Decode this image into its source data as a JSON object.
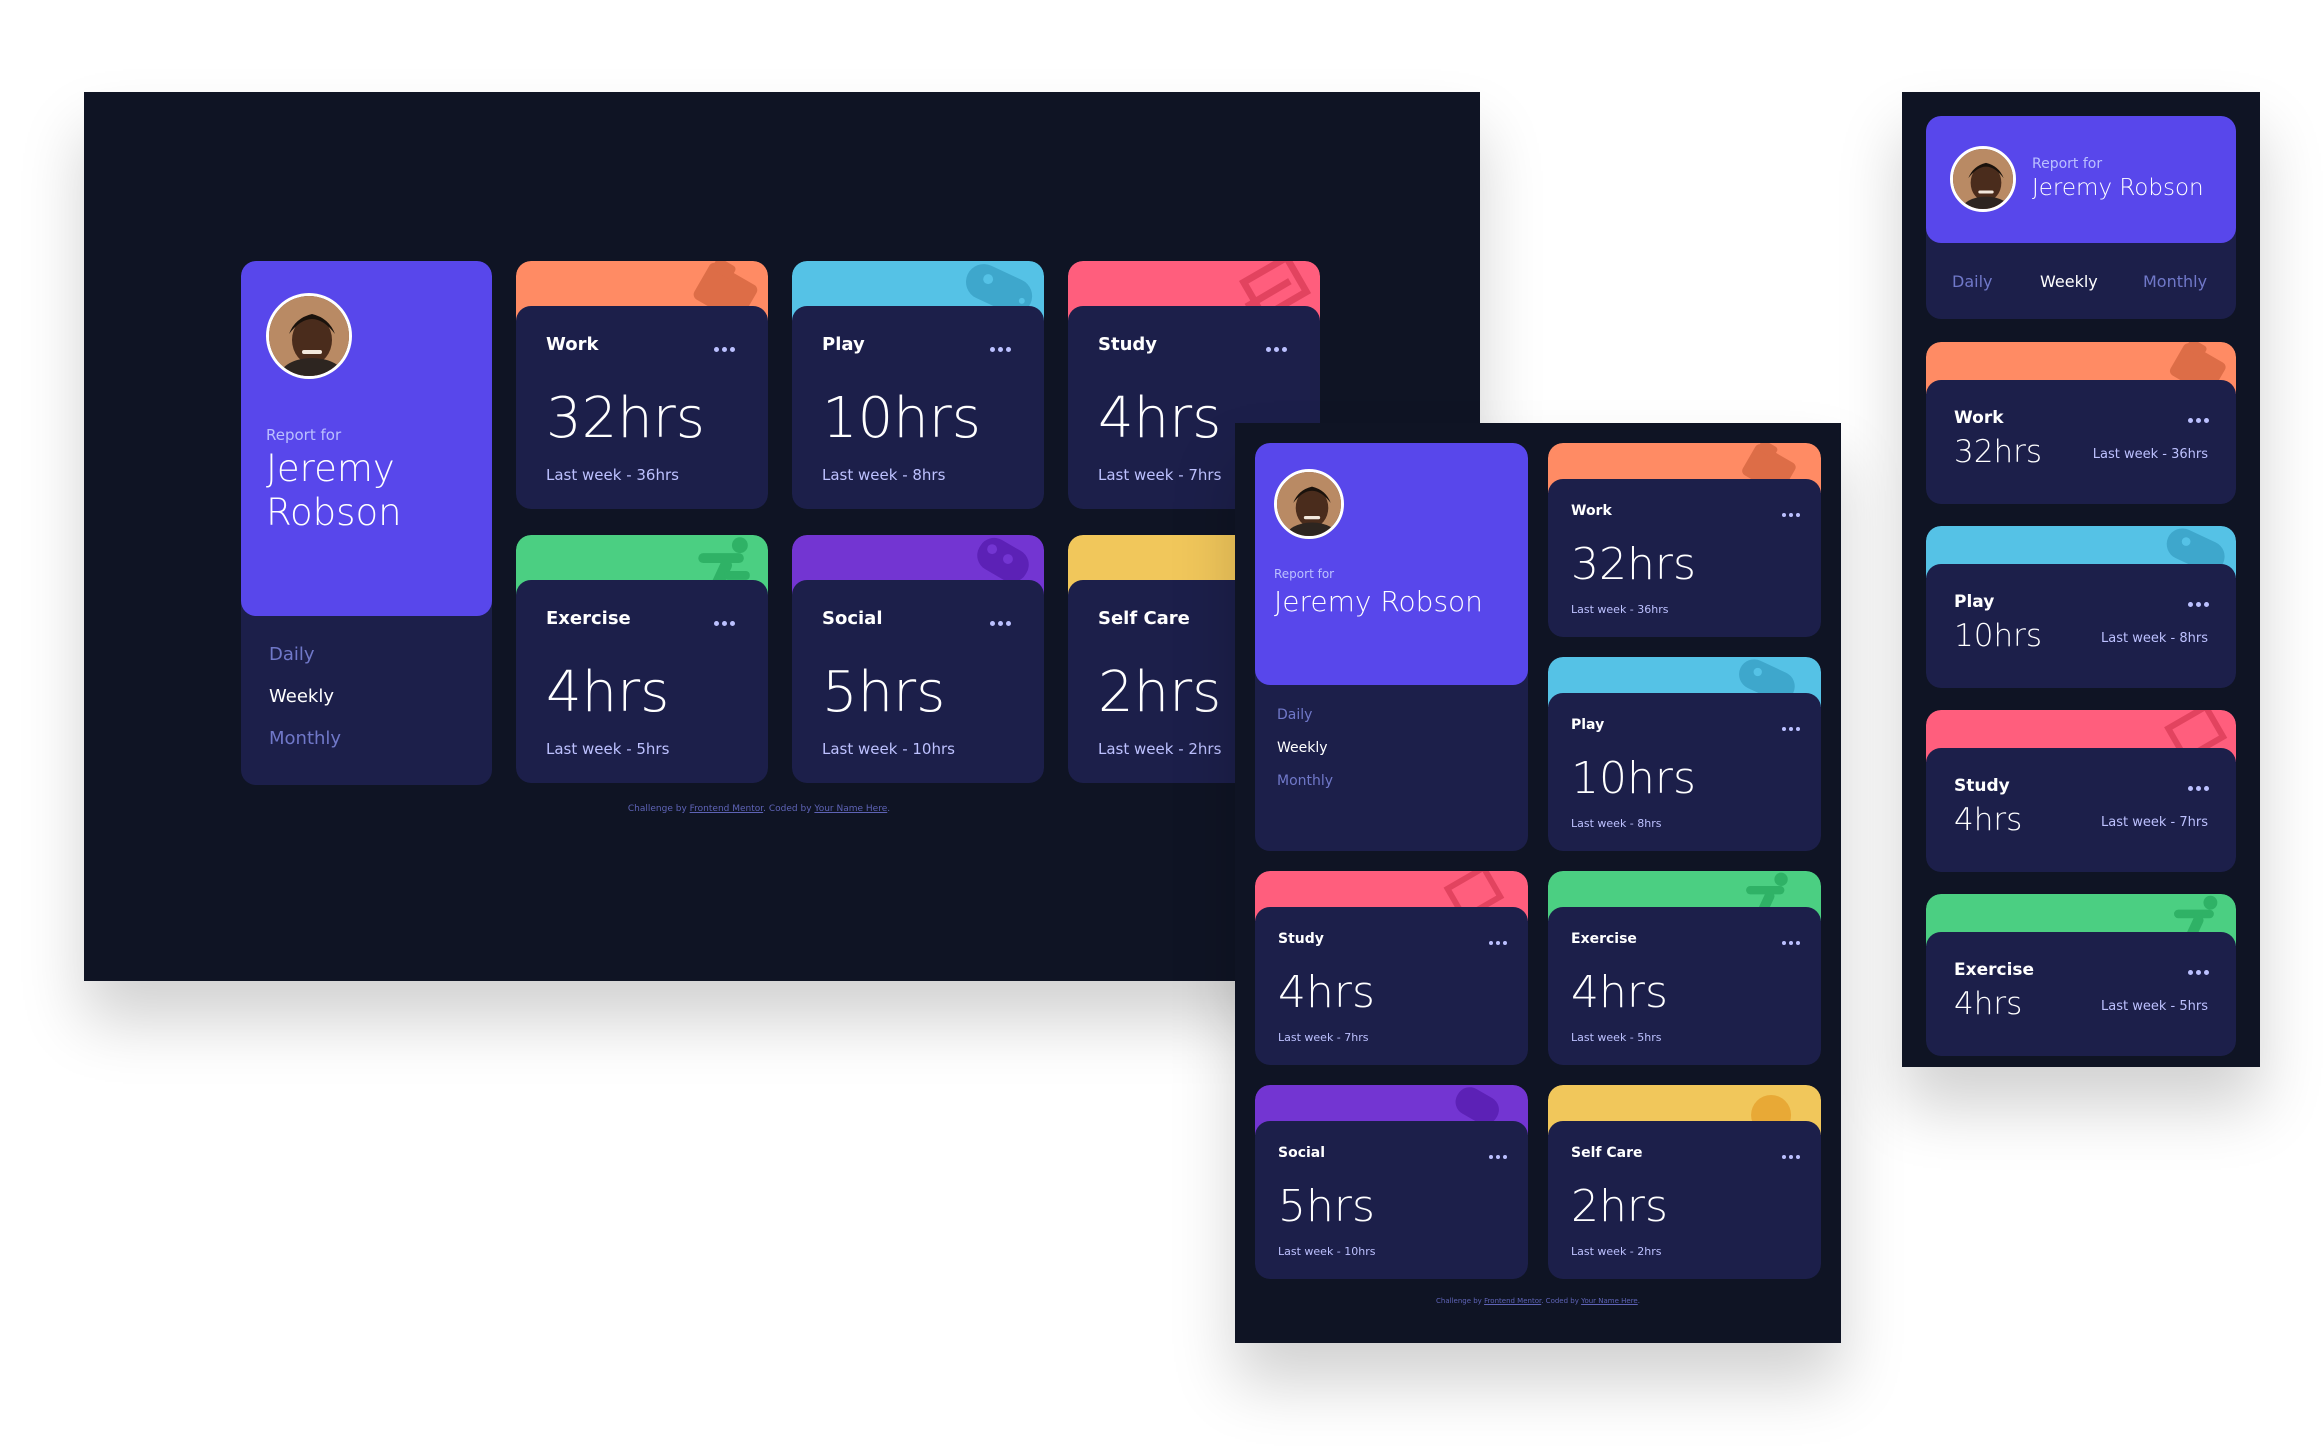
{
  "profile": {
    "report_label": "Report for",
    "name": "Jeremy Robson",
    "periods": {
      "daily": "Daily",
      "weekly": "Weekly",
      "monthly": "Monthly"
    },
    "active_period": "Weekly"
  },
  "activities": {
    "work": {
      "title": "Work",
      "hours": "32hrs",
      "previous": "Last week - 36hrs",
      "color": "#ff8b64",
      "icon": "briefcase-icon"
    },
    "play": {
      "title": "Play",
      "hours": "10hrs",
      "previous": "Last week - 8hrs",
      "color": "#55c2e6",
      "icon": "gamepad-icon"
    },
    "study": {
      "title": "Study",
      "hours": "4hrs",
      "previous": "Last week - 7hrs",
      "color": "#ff5e7d",
      "icon": "book-icon"
    },
    "exercise": {
      "title": "Exercise",
      "hours": "4hrs",
      "previous": "Last week - 5hrs",
      "color": "#4bcf82",
      "icon": "running-icon"
    },
    "social": {
      "title": "Social",
      "hours": "5hrs",
      "previous": "Last week - 10hrs",
      "color": "#7335d2",
      "icon": "social-icon"
    },
    "selfcare": {
      "title": "Self Care",
      "hours": "2hrs",
      "previous": "Last week - 2hrs",
      "color": "#f1c75b",
      "icon": "heart-icon"
    }
  },
  "footer": {
    "prefix": "Challenge by",
    "link1": "Frontend Mentor",
    "middle": ". Coded by",
    "link2": "Your Name Here",
    "suffix": "."
  }
}
